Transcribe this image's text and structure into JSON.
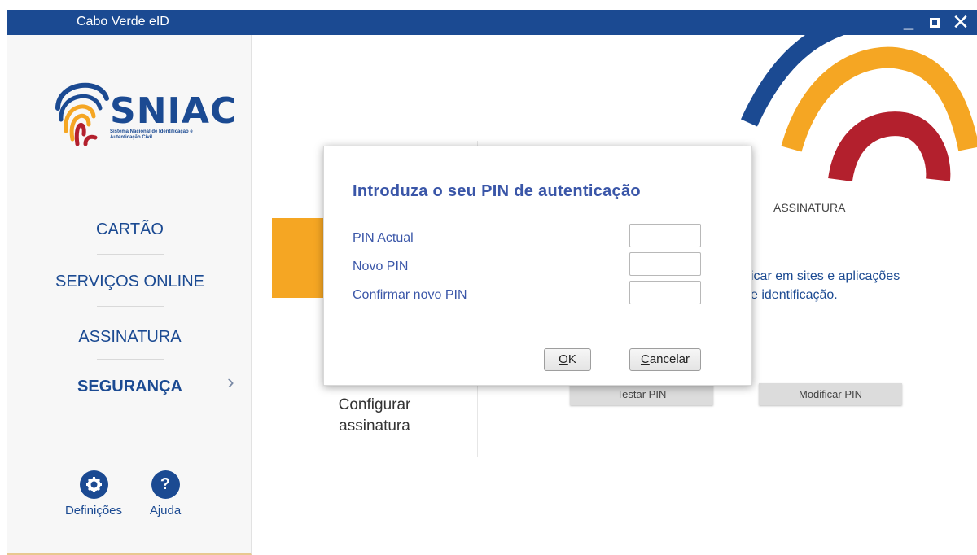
{
  "window": {
    "title": "Cabo Verde eID",
    "minimize_glyph": "_",
    "close_glyph": "✕"
  },
  "logo": {
    "name": "SNIAC",
    "subtitle": "Sistema Nacional de Identificação e Autenticação Civil"
  },
  "sidebar": {
    "items": [
      {
        "label": "CARTÃO"
      },
      {
        "label": "SERVIÇOS ONLINE"
      },
      {
        "label": "ASSINATURA"
      },
      {
        "label": "SEGURANÇA"
      }
    ],
    "active_chevron": "›",
    "footer": {
      "settings_label": "Definições",
      "help_label": "Ajuda",
      "help_glyph": "?"
    }
  },
  "content": {
    "configure_signature": "Configurar assinatura",
    "section_title": "ASSINATURA",
    "description_line1": "icar em sites e aplicações",
    "description_line2": "e identificação.",
    "test_pin_button": "Testar PIN",
    "modify_pin_button": "Modificar PIN"
  },
  "dialog": {
    "title": "Introduza o seu PIN de autenticação",
    "fields": [
      {
        "label": "PIN Actual",
        "value": ""
      },
      {
        "label": "Novo PIN",
        "value": ""
      },
      {
        "label": "Confirmar novo PIN",
        "value": ""
      }
    ],
    "ok_mnemonic": "O",
    "ok_rest": "K",
    "cancel_mnemonic": "C",
    "cancel_rest": "ancelar"
  },
  "colors": {
    "brand_blue": "#1b4a92",
    "orange": "#f5a623",
    "red": "#b3202d"
  },
  "icons": {
    "settings": "gear-icon",
    "help": "help-icon"
  }
}
